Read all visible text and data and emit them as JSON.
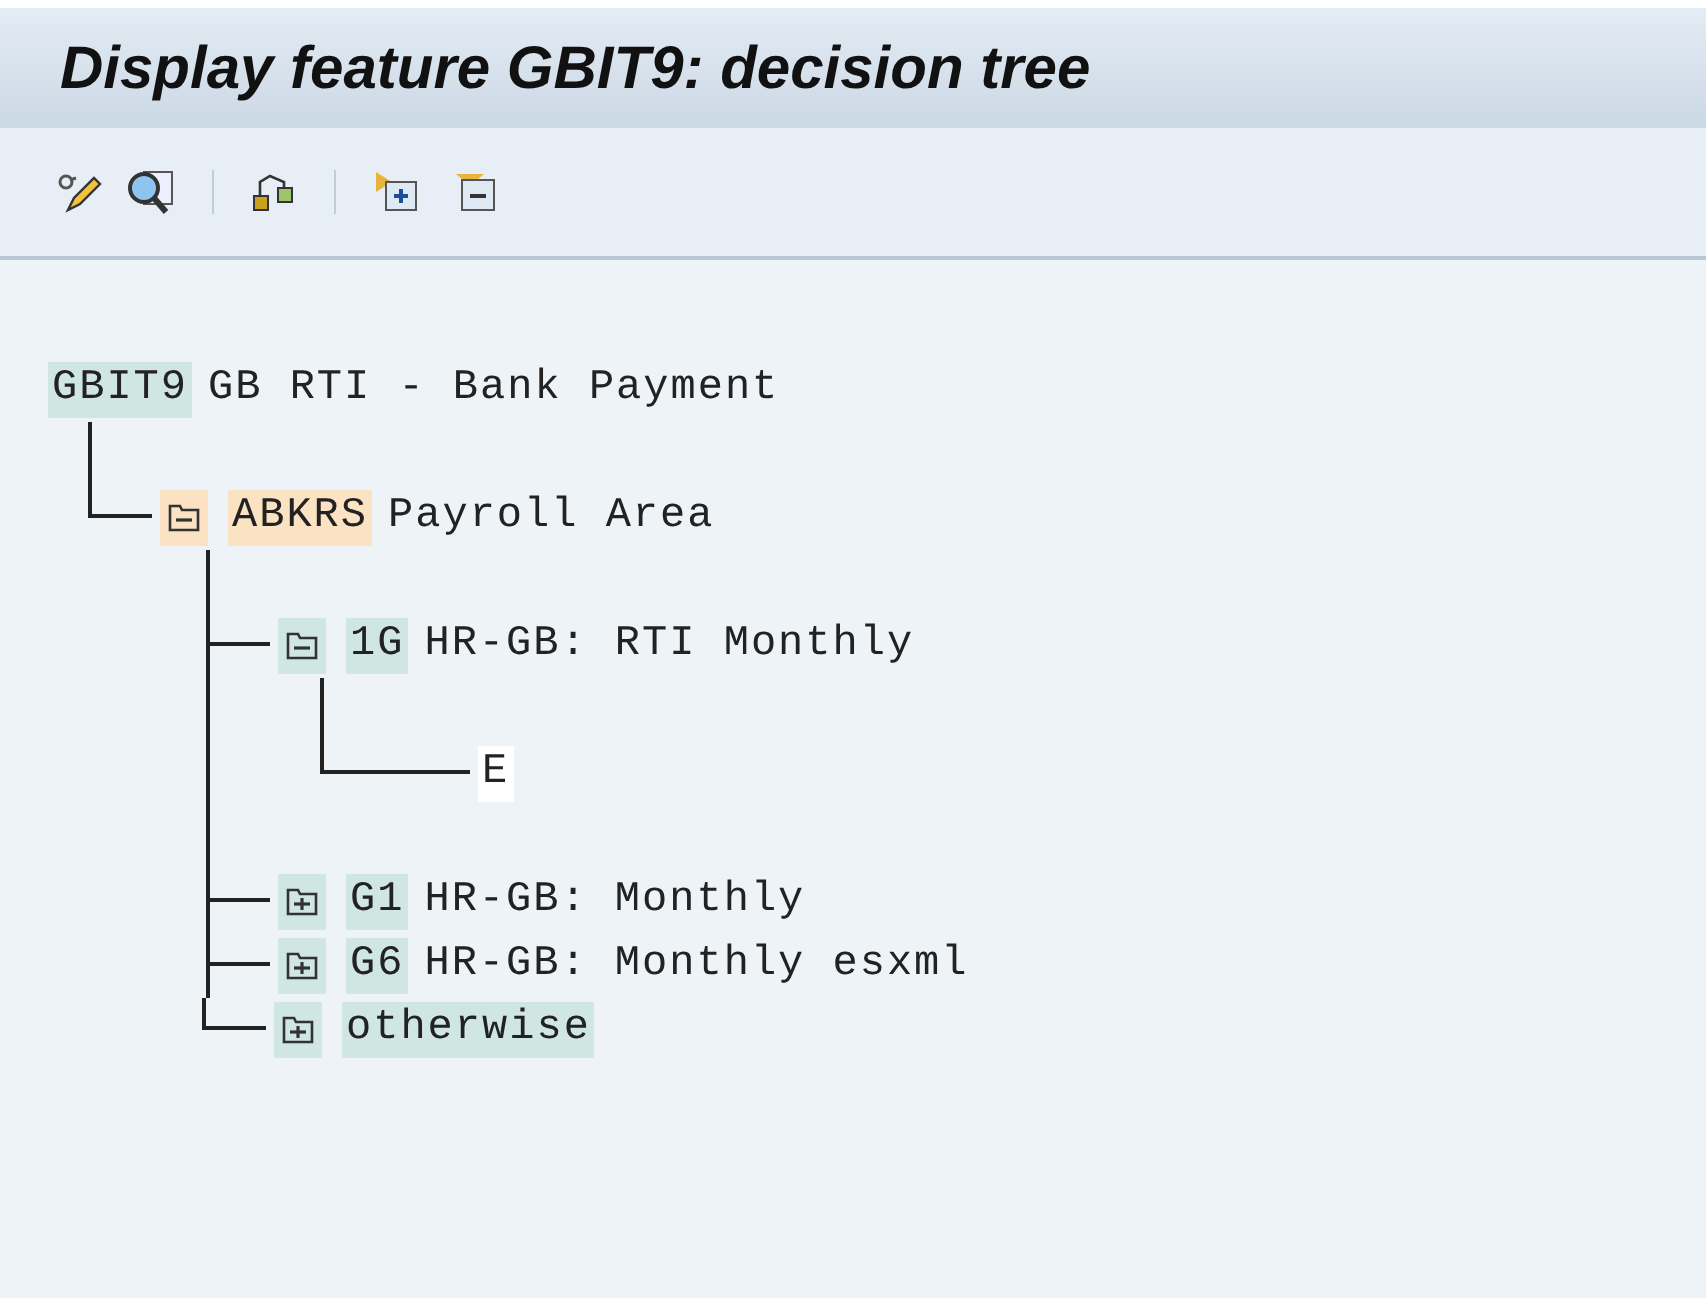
{
  "window": {
    "title": "Display feature GBIT9: decision tree"
  },
  "tree": {
    "kind": "root",
    "key": "GBIT9",
    "text": "GB RTI - Bank Payment",
    "color": "#cfe6e3",
    "children": [
      {
        "kind": "folder",
        "expanded": true,
        "key": "ABKRS",
        "text": "Payroll Area",
        "color": "#fbe2c2",
        "children": [
          {
            "kind": "folder",
            "expanded": true,
            "key": "1G",
            "text": "HR-GB: RTI Monthly",
            "color": "#cfe6e3",
            "children": [
              {
                "kind": "value",
                "key": "E",
                "color": "#ffffff"
              }
            ]
          },
          {
            "kind": "folder",
            "expanded": false,
            "key": "G1",
            "text": "HR-GB: Monthly",
            "color": "#cfe6e3"
          },
          {
            "kind": "folder",
            "expanded": false,
            "key": "G6",
            "text": "HR-GB: Monthly esxml",
            "color": "#cfe6e3"
          },
          {
            "kind": "folder",
            "expanded": false,
            "key": "otherwise",
            "color": "#cfe6e3"
          }
        ]
      }
    ]
  }
}
